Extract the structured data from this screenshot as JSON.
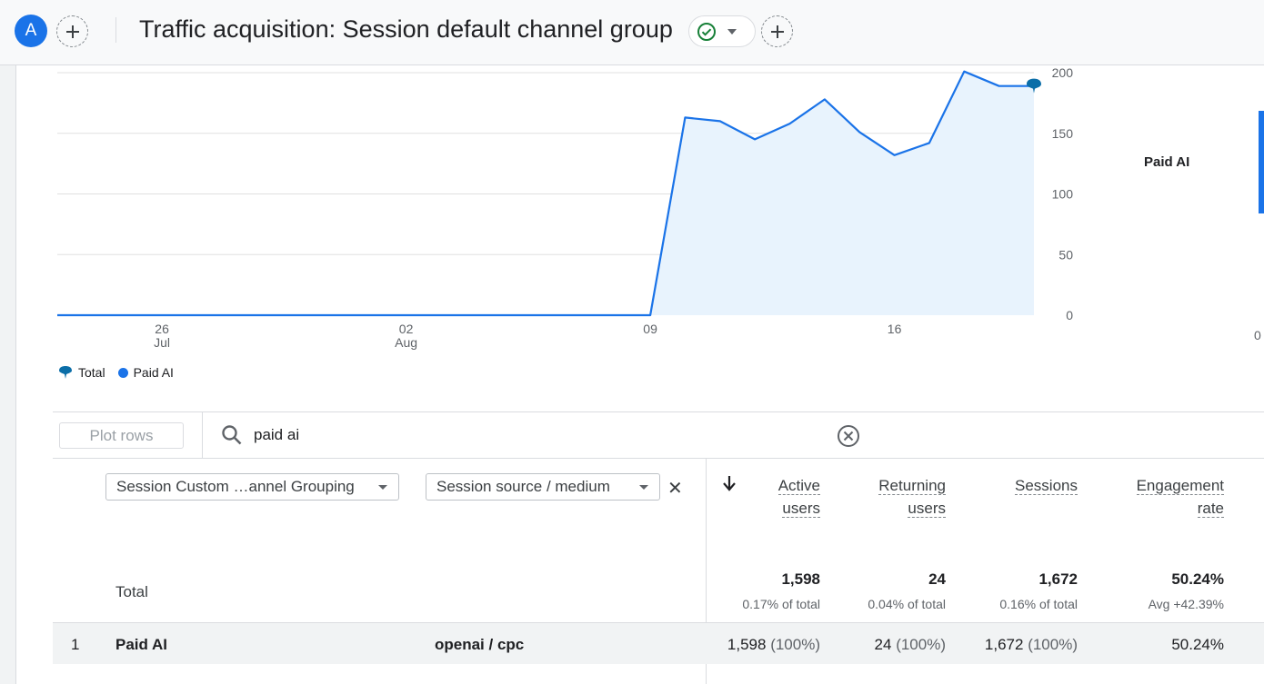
{
  "header": {
    "avatar_letter": "A",
    "title": "Traffic acquisition: Session default channel group"
  },
  "chart_data": {
    "type": "area",
    "x": [
      "Jul 23",
      "Jul 24",
      "Jul 25",
      "Jul 26",
      "Jul 27",
      "Jul 28",
      "Jul 29",
      "Jul 30",
      "Jul 31",
      "Aug 01",
      "Aug 02",
      "Aug 03",
      "Aug 04",
      "Aug 05",
      "Aug 06",
      "Aug 07",
      "Aug 08",
      "Aug 09",
      "Aug 10",
      "Aug 11",
      "Aug 12",
      "Aug 13",
      "Aug 14",
      "Aug 15",
      "Aug 16",
      "Aug 17",
      "Aug 18",
      "Aug 19",
      "Aug 20"
    ],
    "series": [
      {
        "name": "Paid AI",
        "values": [
          0,
          0,
          0,
          0,
          0,
          0,
          0,
          0,
          0,
          0,
          0,
          0,
          0,
          0,
          0,
          0,
          0,
          0,
          163,
          160,
          145,
          158,
          178,
          151,
          132,
          142,
          201,
          189,
          189
        ]
      },
      {
        "name": "Total",
        "values": [
          null,
          null,
          null,
          null,
          null,
          null,
          null,
          null,
          null,
          null,
          null,
          null,
          null,
          null,
          null,
          null,
          null,
          null,
          null,
          null,
          null,
          null,
          null,
          null,
          null,
          null,
          null,
          null,
          189
        ]
      }
    ],
    "x_ticks": [
      {
        "day": "26",
        "month": "Jul"
      },
      {
        "day": "02",
        "month": "Aug"
      },
      {
        "day": "09",
        "month": ""
      },
      {
        "day": "16",
        "month": ""
      }
    ],
    "y_ticks": [
      "0",
      "50",
      "100",
      "150",
      "200"
    ],
    "ylim": [
      0,
      200
    ],
    "legend": [
      "Total",
      "Paid AI"
    ],
    "colors": {
      "paid_ai": "#1a73e8",
      "total": "#0b6ea8",
      "fill": "#e8f3fd"
    }
  },
  "side_panel": {
    "label": "Paid AI",
    "zero": "0"
  },
  "toolbar": {
    "plot_rows_label": "Plot rows",
    "search_value": "paid ai"
  },
  "table": {
    "dim1": "Session Custom …annel Grouping",
    "dim2": "Session source / medium",
    "columns": [
      {
        "line1": "Active",
        "line2": "users"
      },
      {
        "line1": "Returning",
        "line2": "users"
      },
      {
        "line1": "Sessions",
        "line2": ""
      },
      {
        "line1": "Engagement",
        "line2": "rate"
      }
    ],
    "total": {
      "label": "Total",
      "values": [
        "1,598",
        "24",
        "1,672",
        "50.24%"
      ],
      "subs": [
        "0.17% of total",
        "0.04% of total",
        "0.16% of total",
        "Avg +42.39%"
      ]
    },
    "rows": [
      {
        "index": "1",
        "channel": "Paid AI",
        "source": "openai / cpc",
        "active_users": "1,598",
        "active_users_pct": "(100%)",
        "returning_users": "24",
        "returning_users_pct": "(100%)",
        "sessions": "1,672",
        "sessions_pct": "(100%)",
        "engagement_rate": "50.24%"
      }
    ]
  }
}
